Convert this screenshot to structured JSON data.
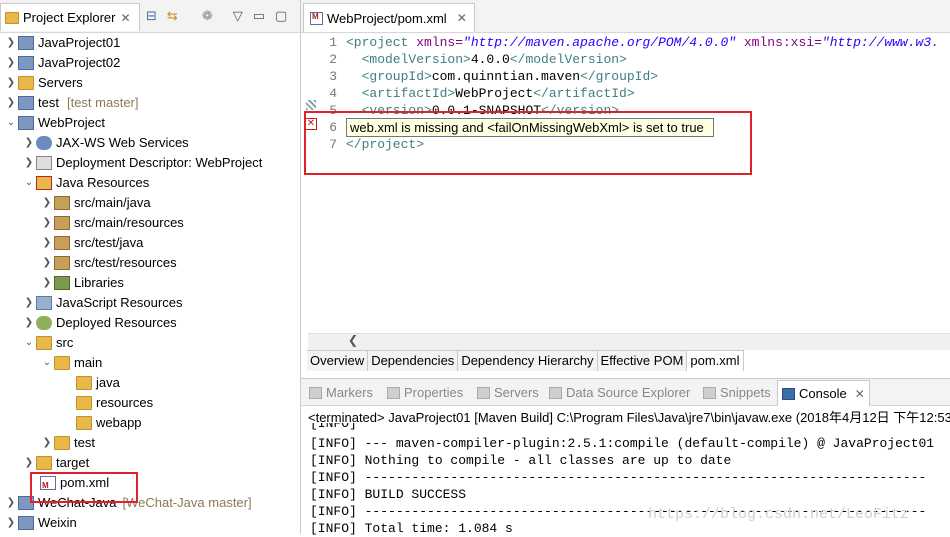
{
  "explorer": {
    "tab_label": "Project Explorer",
    "items": [
      {
        "label": "JavaProject01",
        "extra": ""
      },
      {
        "label": "JavaProject02",
        "extra": ""
      },
      {
        "label": "Servers",
        "extra": ""
      },
      {
        "label": "test",
        "extra": "[test master]"
      },
      {
        "label": "WebProject",
        "extra": ""
      },
      {
        "label": "JAX-WS Web Services",
        "extra": ""
      },
      {
        "label": "Deployment Descriptor: WebProject",
        "extra": ""
      },
      {
        "label": "Java Resources",
        "extra": ""
      },
      {
        "label": "src/main/java",
        "extra": ""
      },
      {
        "label": "src/main/resources",
        "extra": ""
      },
      {
        "label": "src/test/java",
        "extra": ""
      },
      {
        "label": "src/test/resources",
        "extra": ""
      },
      {
        "label": "Libraries",
        "extra": ""
      },
      {
        "label": "JavaScript Resources",
        "extra": ""
      },
      {
        "label": "Deployed Resources",
        "extra": ""
      },
      {
        "label": "src",
        "extra": ""
      },
      {
        "label": "main",
        "extra": ""
      },
      {
        "label": "java",
        "extra": ""
      },
      {
        "label": "resources",
        "extra": ""
      },
      {
        "label": "webapp",
        "extra": ""
      },
      {
        "label": "test",
        "extra": ""
      },
      {
        "label": "target",
        "extra": ""
      },
      {
        "label": "pom.xml",
        "extra": ""
      },
      {
        "label": "WeChat-Java",
        "extra": "[WeChat-Java master]"
      },
      {
        "label": "Weixin",
        "extra": ""
      }
    ]
  },
  "editor": {
    "tab_label": "WebProject/pom.xml",
    "line_numbers": [
      "1",
      "2",
      "3",
      "4",
      "5",
      "6",
      "7"
    ],
    "code": {
      "l1_open": "<project ",
      "l1_attr1": "xmlns=",
      "l1_val1": "\"http://maven.apache.org/POM/4.0.0\"",
      "l1_attr2": " xmlns:xsi=",
      "l1_val2": "\"http://www.w3.",
      "l2_open": "  <modelVersion>",
      "l2_text": "4.0.0",
      "l2_close": "</modelVersion>",
      "l3_open": "  <groupId>",
      "l3_text": "com.quinntian.maven",
      "l3_close": "</groupId>",
      "l4_open": "  <artifactId>",
      "l4_text": "WebProject",
      "l4_close": "</artifactId>",
      "l5_open": "  <version>",
      "l5_text": "0.0.1-SNAPSHOT",
      "l5_close": "</version>",
      "l7_close": "</project>"
    },
    "tooltip": "web.xml is missing and <failOnMissingWebXml> is set to true",
    "bottom_tabs": [
      "Overview",
      "Dependencies",
      "Dependency Hierarchy",
      "Effective POM",
      "pom.xml"
    ]
  },
  "console": {
    "tabs": [
      "Markers",
      "Properties",
      "Servers",
      "Data Source Explorer",
      "Snippets",
      "Console"
    ],
    "terminated": "<terminated> JavaProject01 [Maven Build] C:\\Program Files\\Java\\jre7\\bin\\javaw.exe (2018年4月12日 下午12:53:",
    "lines": [
      "[INFO]",
      "[INFO] --- maven-compiler-plugin:2.5.1:compile (default-compile) @ JavaProject01",
      "[INFO] Nothing to compile - all classes are up to date",
      "[INFO] ------------------------------------------------------------------------",
      "[INFO] BUILD SUCCESS",
      "[INFO] ------------------------------------------------------------------------",
      "[INFO] Total time: 1.084 s"
    ]
  },
  "watermark": "https://blog.csdn.net/LeoFitz"
}
